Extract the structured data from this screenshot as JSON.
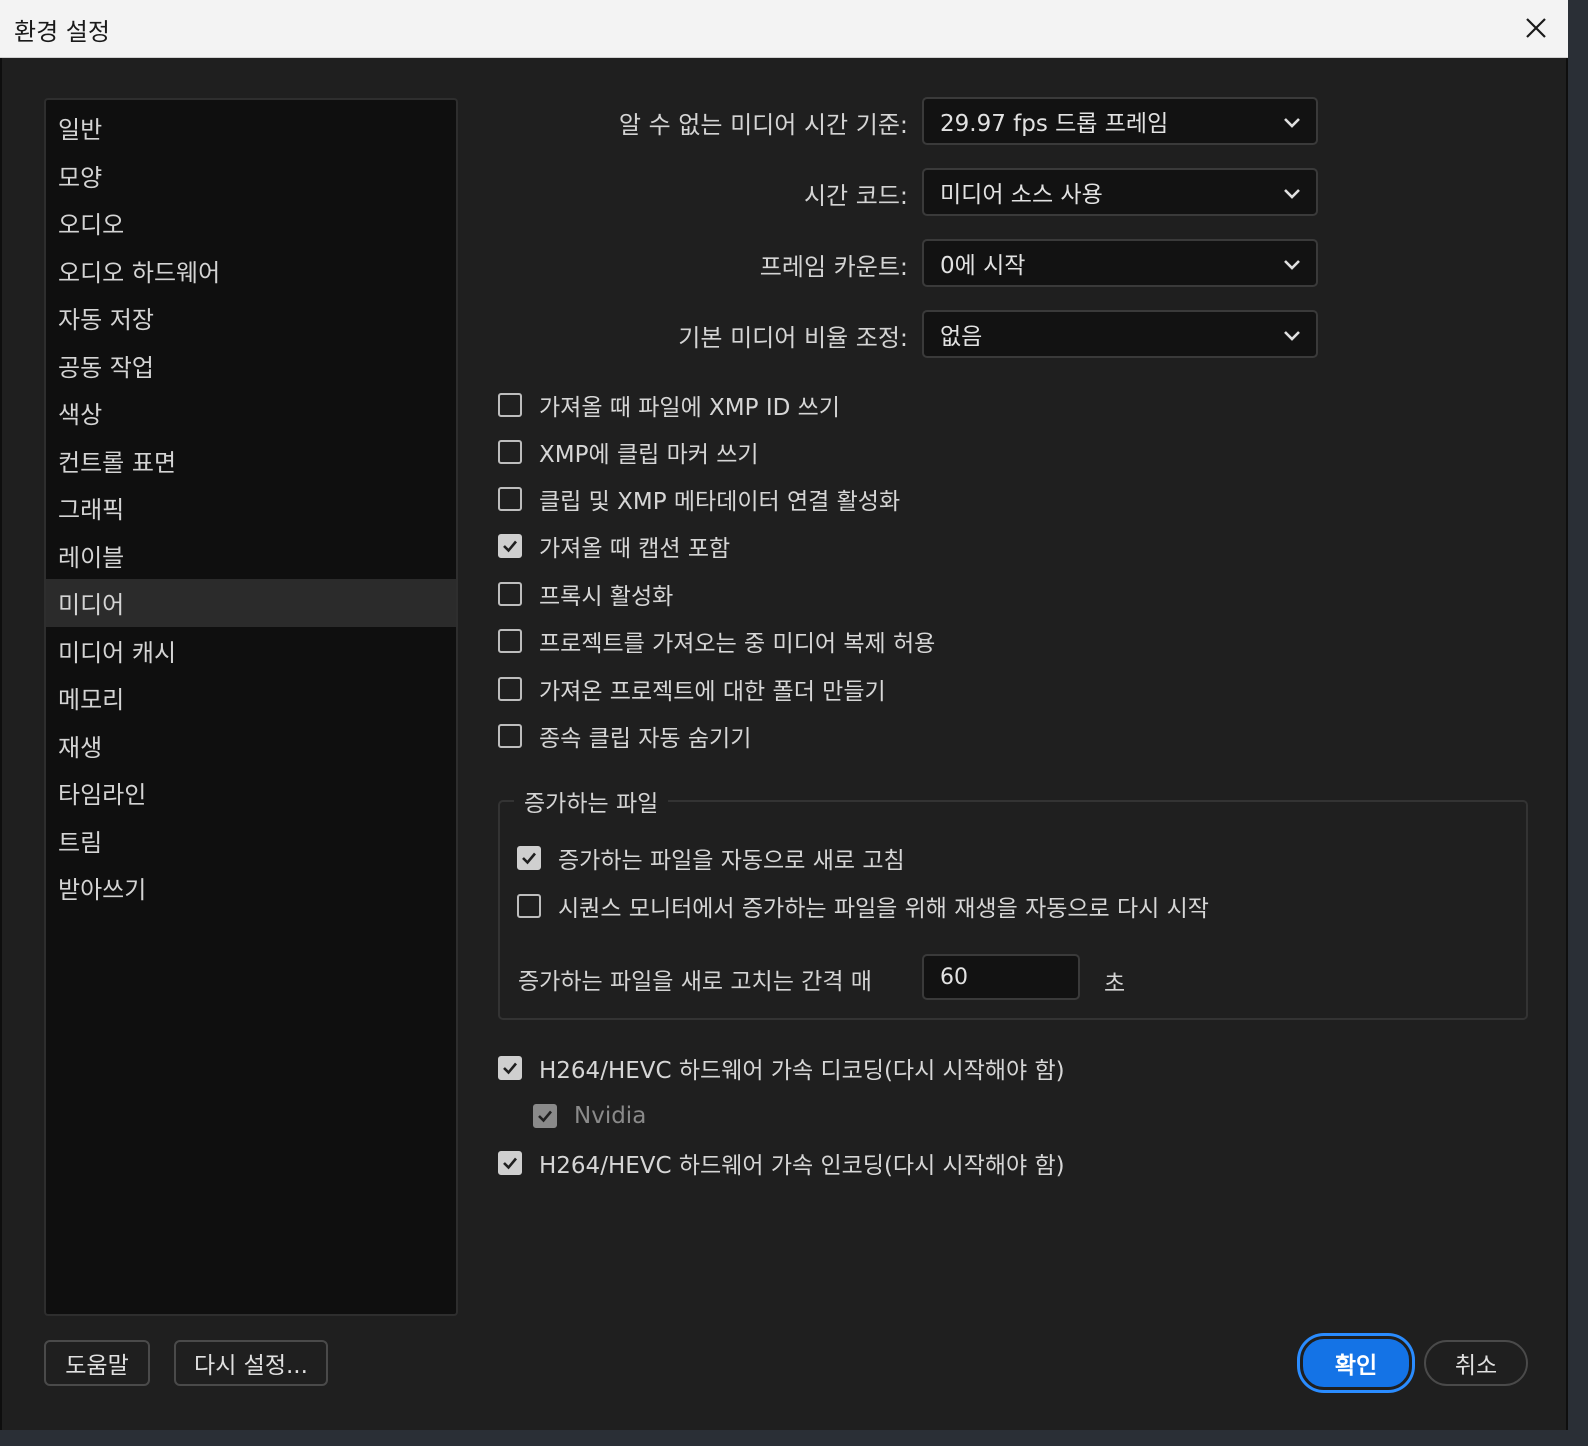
{
  "window": {
    "title": "환경 설정"
  },
  "sidebar": {
    "items": [
      {
        "label": "일반"
      },
      {
        "label": "모양"
      },
      {
        "label": "오디오"
      },
      {
        "label": "오디오 하드웨어"
      },
      {
        "label": "자동 저장"
      },
      {
        "label": "공동 작업"
      },
      {
        "label": "색상"
      },
      {
        "label": "컨트롤 표면"
      },
      {
        "label": "그래픽"
      },
      {
        "label": "레이블"
      },
      {
        "label": "미디어"
      },
      {
        "label": "미디어 캐시"
      },
      {
        "label": "메모리"
      },
      {
        "label": "재생"
      },
      {
        "label": "타임라인"
      },
      {
        "label": "트림"
      },
      {
        "label": "받아쓰기"
      }
    ],
    "active_item": "미디어"
  },
  "fields": {
    "timebase": {
      "label": "알 수 없는 미디어 시간 기준:",
      "value": "29.97 fps 드롭 프레임"
    },
    "timecode": {
      "label": "시간 코드:",
      "value": "미디어 소스 사용"
    },
    "frame_count": {
      "label": "프레임 카운트:",
      "value": "0에 시작"
    },
    "scaling": {
      "label": "기본 미디어 비율 조정:",
      "value": "없음"
    }
  },
  "checkboxes": {
    "xmp_id": {
      "label": "가져올 때 파일에 XMP ID 쓰기",
      "checked": false
    },
    "xmp_markers": {
      "label": "XMP에 클립 마커 쓰기",
      "checked": false
    },
    "xmp_link": {
      "label": "클립 및 XMP 메타데이터 연결 활성화",
      "checked": false
    },
    "captions": {
      "label": "가져올 때 캡션 포함",
      "checked": true
    },
    "proxies": {
      "label": "프록시 활성화",
      "checked": false
    },
    "duplicate_media": {
      "label": "프로젝트를 가져오는 중 미디어 복제 허용",
      "checked": false
    },
    "bins": {
      "label": "가져온 프로젝트에 대한 폴더 만들기",
      "checked": false
    },
    "hide_subclips": {
      "label": "종속 클립 자동 숨기기",
      "checked": false
    }
  },
  "growing_files": {
    "legend": "증가하는 파일",
    "auto_refresh": {
      "label": "증가하는 파일을 자동으로 새로 고침",
      "checked": true
    },
    "auto_restart": {
      "label": "시퀀스 모니터에서 증가하는 파일을 위해 재생을 자동으로 다시 시작",
      "checked": false
    },
    "interval_label": "증가하는 파일을 새로 고치는 간격 매",
    "interval_value": "60",
    "interval_unit": "초"
  },
  "hardware": {
    "decode": {
      "label": "H264/HEVC 하드웨어 가속 디코딩(다시 시작해야 함)",
      "checked": true
    },
    "nvidia": {
      "label": "Nvidia",
      "checked": true,
      "disabled": true
    },
    "encode": {
      "label": "H264/HEVC 하드웨어 가속 인코딩(다시 시작해야 함)",
      "checked": true
    }
  },
  "buttons": {
    "help": "도움말",
    "reset": "다시 설정...",
    "ok": "확인",
    "cancel": "취소"
  },
  "colors": {
    "accent": "#1473e6",
    "background": "#1f1f1f",
    "sidebar_bg": "#0f0f0f",
    "titlebar_bg": "#f3f3f3"
  }
}
